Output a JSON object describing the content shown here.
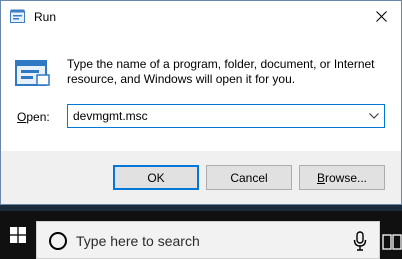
{
  "dialog": {
    "title": "Run",
    "description": "Type the name of a program, folder, document, or Internet resource, and Windows will open it for you.",
    "open_label_accesskey": "O",
    "open_label_rest": "pen:",
    "open_value": "devmgmt.msc",
    "icons": {
      "title": "run-icon",
      "large": "run-icon",
      "close": "close-icon",
      "dropdown": "chevron-down-icon"
    }
  },
  "buttons": {
    "ok": "OK",
    "cancel": "Cancel",
    "browse_accesskey": "B",
    "browse_rest": "rowse..."
  },
  "taskbar": {
    "search_placeholder": "Type here to search",
    "icons": {
      "start": "windows-logo-icon",
      "search": "search-circle-icon",
      "mic": "microphone-icon",
      "task_view": "task-view-icon"
    }
  },
  "colors": {
    "accent": "#0078d7",
    "taskbar": "#101010",
    "dialog_border": "#6b86a8"
  }
}
